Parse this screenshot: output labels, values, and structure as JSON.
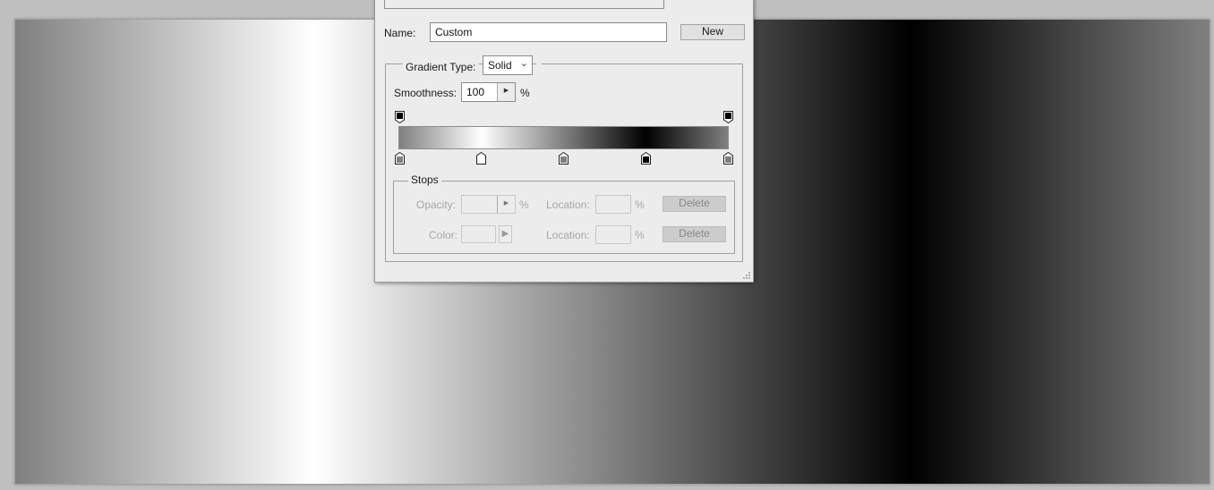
{
  "canvas": {
    "gradient_stops": [
      {
        "location": 0,
        "color": "#808080"
      },
      {
        "location": 25,
        "color": "#ffffff"
      },
      {
        "location": 50,
        "color": "#808080"
      },
      {
        "location": 75,
        "color": "#000000"
      },
      {
        "location": 100,
        "color": "#808080"
      }
    ]
  },
  "dialog": {
    "name_label": "Name:",
    "name_value": "Custom",
    "new_button": "New",
    "gradient_type_label": "Gradient Type:",
    "gradient_type_value": "Solid",
    "smoothness_label": "Smoothness:",
    "smoothness_value": "100",
    "smoothness_unit": "%",
    "opacity_stops": [
      {
        "location": 0,
        "color": "#000000"
      },
      {
        "location": 100,
        "color": "#000000"
      }
    ],
    "color_stops": [
      {
        "location": 0,
        "color": "#808080"
      },
      {
        "location": 25,
        "color": "#ffffff"
      },
      {
        "location": 50,
        "color": "#808080"
      },
      {
        "location": 75,
        "color": "#000000"
      },
      {
        "location": 100,
        "color": "#808080"
      }
    ],
    "stops": {
      "legend": "Stops",
      "opacity_label": "Opacity:",
      "opacity_value": "",
      "opacity_unit": "%",
      "opacity_location_label": "Location:",
      "opacity_location_value": "",
      "opacity_location_unit": "%",
      "opacity_delete": "Delete",
      "color_label": "Color:",
      "color_location_label": "Location:",
      "color_location_value": "",
      "color_location_unit": "%",
      "color_delete": "Delete"
    }
  }
}
